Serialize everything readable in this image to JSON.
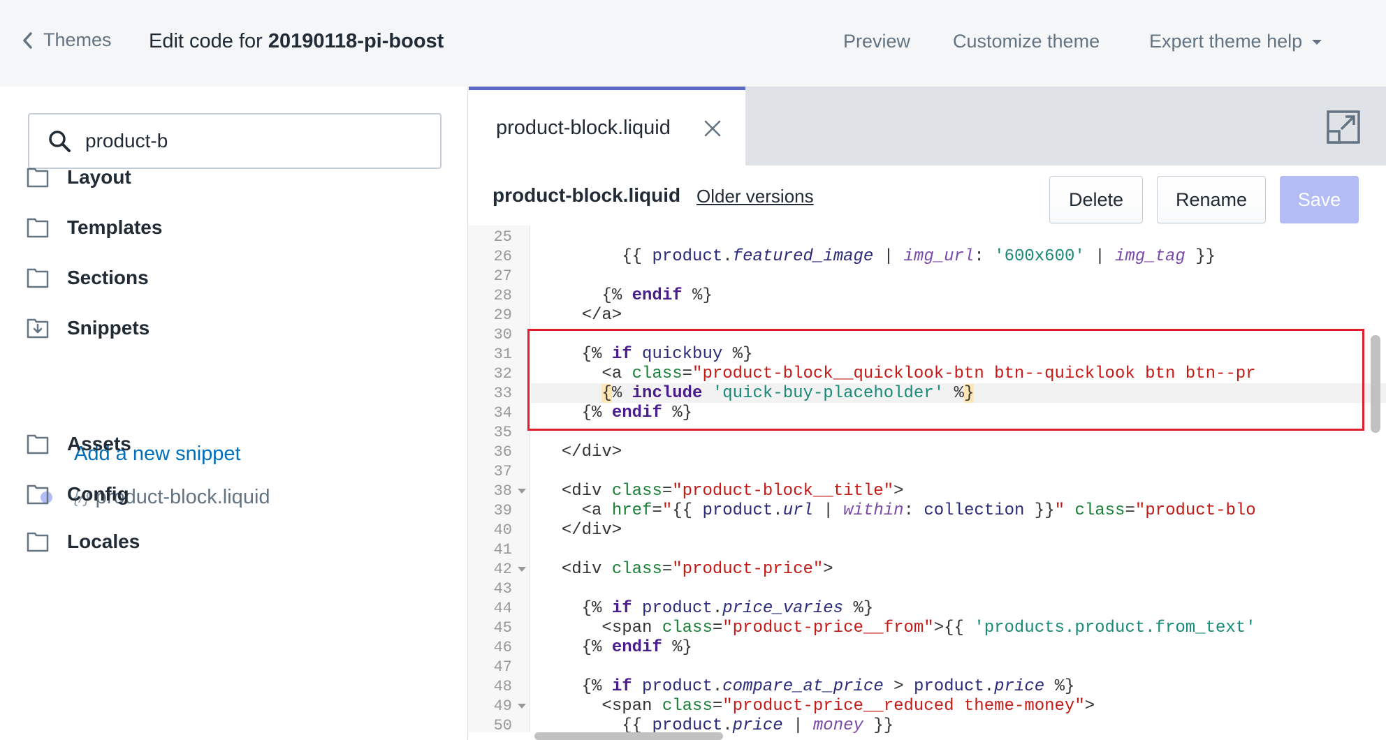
{
  "topbar": {
    "back_label": "Themes",
    "title_prefix": "Edit code for ",
    "title_theme": "20190118-pi-boost",
    "links": {
      "preview": "Preview",
      "customize": "Customize theme",
      "help": "Expert theme help"
    }
  },
  "sidebar": {
    "search_value": "product-b",
    "folders": {
      "layout": "Layout",
      "templates": "Templates",
      "sections": "Sections",
      "snippets": "Snippets",
      "assets": "Assets",
      "config": "Config",
      "locales": "Locales"
    },
    "add_snippet": "Add a new snippet",
    "file_icon": "{/}",
    "file_name": "product-block.liquid"
  },
  "editor": {
    "tab_name": "product-block.liquid",
    "file_name": "product-block.liquid",
    "older_versions": "Older versions",
    "buttons": {
      "delete": "Delete",
      "rename": "Rename",
      "save": "Save"
    },
    "line_numbers": [
      "25",
      "26",
      "27",
      "28",
      "29",
      "30",
      "31",
      "32",
      "33",
      "34",
      "35",
      "36",
      "37",
      "38",
      "39",
      "40",
      "41",
      "42",
      "43",
      "44",
      "45",
      "46",
      "47",
      "48",
      "49",
      "50"
    ]
  },
  "colors": {
    "accent": "#5c6ac4",
    "save_disabled": "#b3bcf5",
    "highlight_box": "#e01e2d",
    "link": "#006fbb"
  },
  "icons": [
    "chevron-left-icon",
    "search-icon",
    "folder-icon",
    "folder-download-icon",
    "close-icon",
    "expand-icon",
    "caret-down-icon"
  ]
}
